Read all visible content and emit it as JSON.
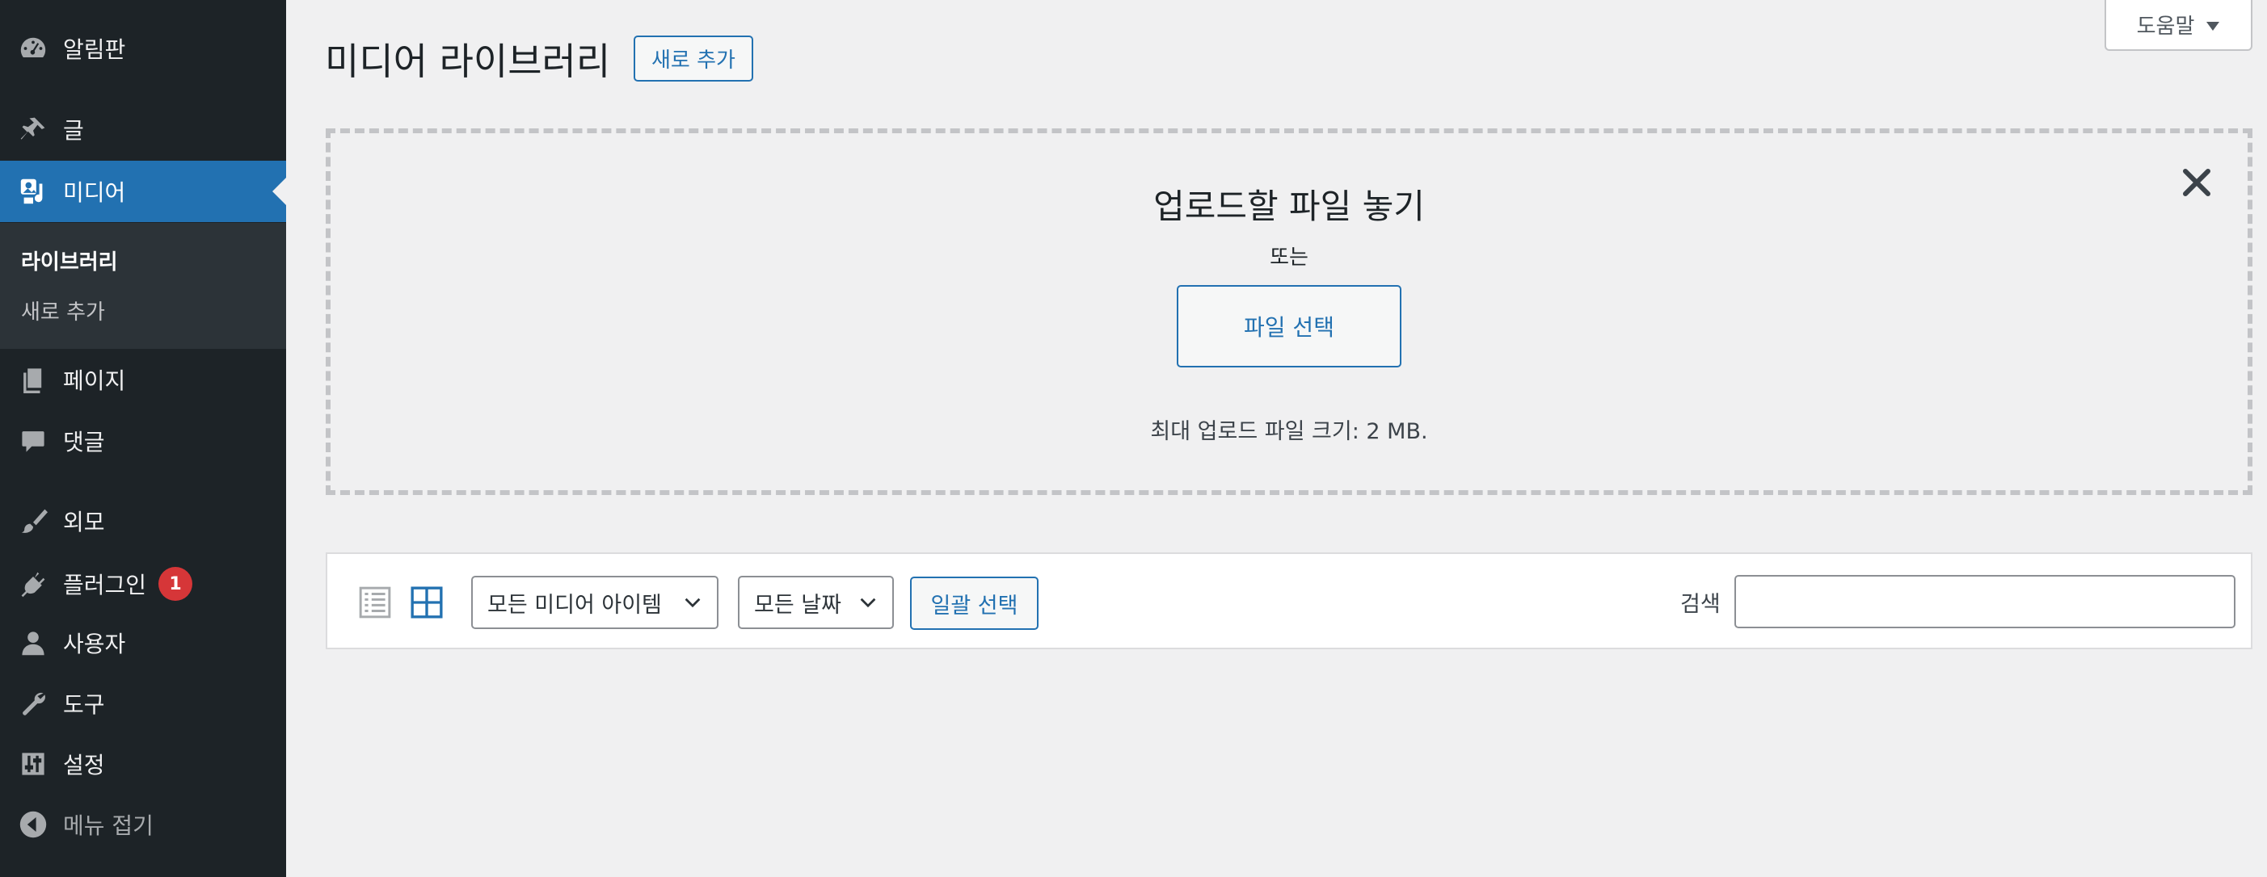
{
  "sidebar": {
    "dashboard": "알림판",
    "posts": "글",
    "media": "미디어",
    "media_submenu": {
      "library": "라이브러리",
      "add_new": "새로 추가"
    },
    "pages": "페이지",
    "comments": "댓글",
    "appearance": "외모",
    "plugins": "플러그인",
    "plugins_badge": "1",
    "users": "사용자",
    "tools": "도구",
    "settings": "설정",
    "collapse": "메뉴 접기"
  },
  "help": {
    "label": "도움말"
  },
  "header": {
    "title": "미디어 라이브러리",
    "add_new": "새로 추가"
  },
  "uploader": {
    "title": "업로드할 파일 놓기",
    "or": "또는",
    "select_files": "파일 선택",
    "max_size": "최대 업로드 파일 크기: 2 MB."
  },
  "toolbar": {
    "filter_type": "모든 미디어 아이템",
    "filter_date": "모든 날짜",
    "bulk_select": "일괄 선택",
    "search_label": "검색",
    "search_value": ""
  },
  "colors": {
    "accent": "#2271b1",
    "sidebar_bg": "#1d2327",
    "badge": "#d63638"
  }
}
